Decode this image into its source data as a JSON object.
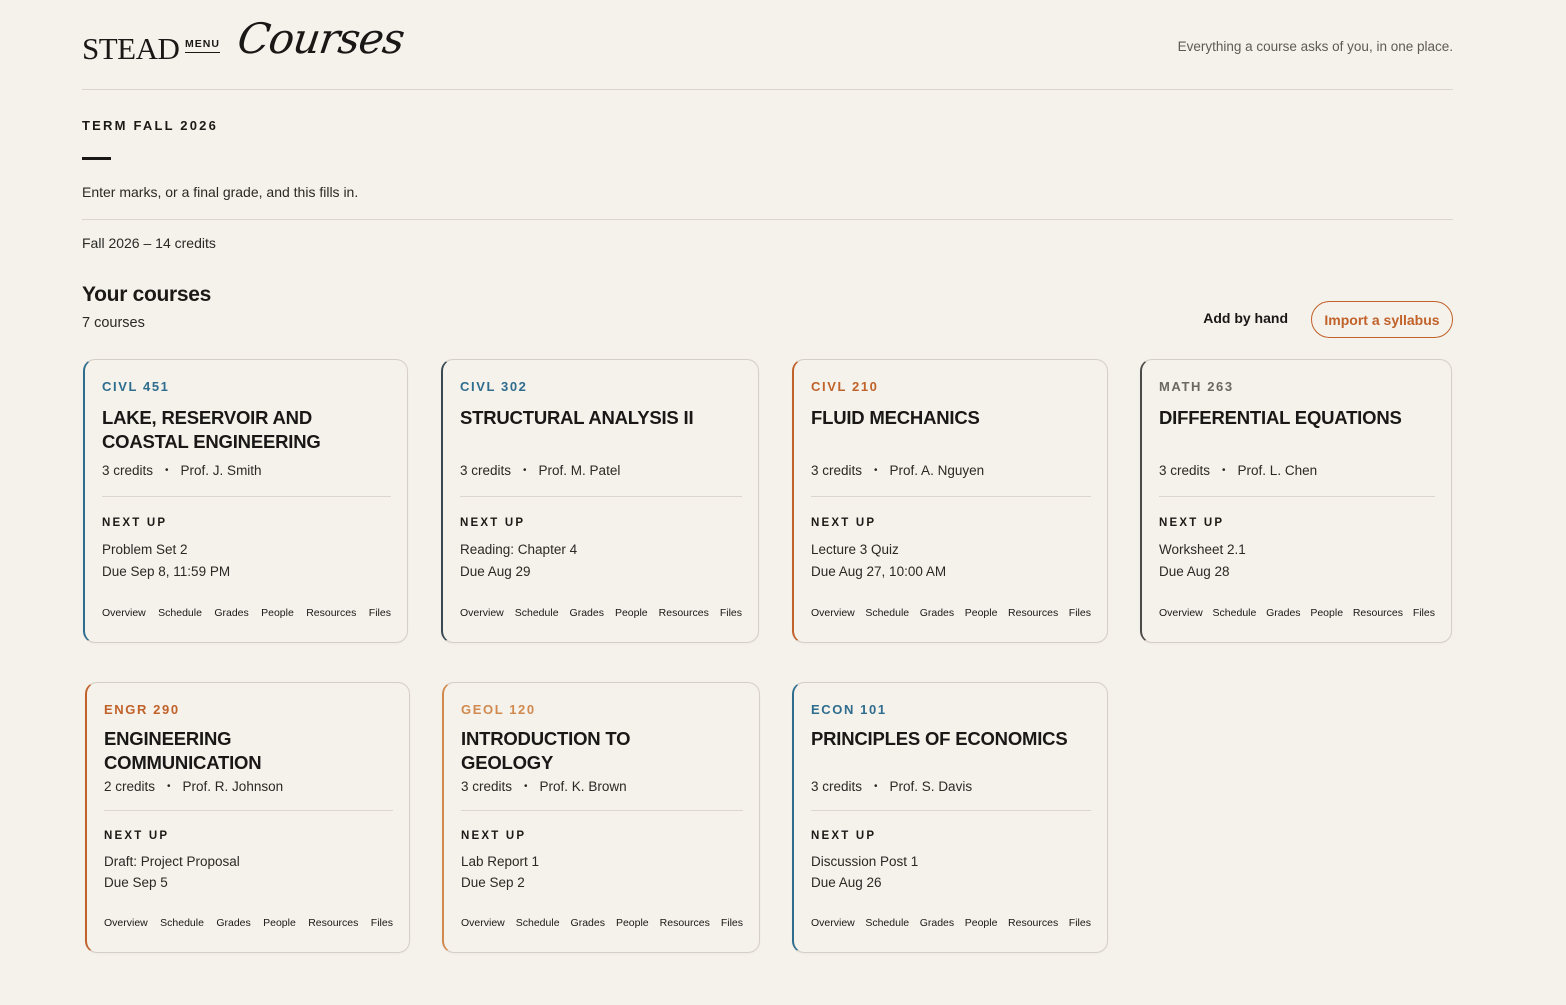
{
  "header": {
    "logo": "STEAD",
    "menu": "MENU",
    "section_title": "Courses",
    "tagline": "Everything a course asks of you, in one place."
  },
  "term": {
    "label": "TERM FALL 2026",
    "hint": "Enter marks, or a final grade, and this fills in.",
    "summary": "Fall 2026 – 14 credits"
  },
  "courses_section": {
    "title": "Your courses",
    "count": "7 courses",
    "add_by_hand": "Add by hand",
    "import_syllabus": "Import a syllabus"
  },
  "colors": {
    "blue": "#2e6d8e",
    "slate": "#3b4a52",
    "orange": "#c0622a",
    "amber": "#d08a4f",
    "gray": "#6b6863"
  },
  "card_links": [
    "Overview",
    "Schedule",
    "Grades",
    "People",
    "Resources",
    "Files"
  ],
  "next_up_label": "NEXT UP",
  "courses": [
    {
      "code": "CIVL 451",
      "title": "LAKE, RESERVOIR AND COASTAL ENGINEERING",
      "credits": "3 credits",
      "prof": "Prof. J. Smith",
      "next_item": "Problem Set 2",
      "next_due": "Due Sep 8, 11:59 PM",
      "accent": "#2e6d8e",
      "border": "#2e6d8e"
    },
    {
      "code": "CIVL 302",
      "title": "STRUCTURAL ANALYSIS II",
      "credits": "3 credits",
      "prof": "Prof. M. Patel",
      "next_item": "Reading: Chapter 4",
      "next_due": "Due Aug 29",
      "accent": "#2e6d8e",
      "border": "#3b4a52"
    },
    {
      "code": "CIVL 210",
      "title": "FLUID MECHANICS",
      "credits": "3 credits",
      "prof": "Prof. A. Nguyen",
      "next_item": "Lecture 3 Quiz",
      "next_due": "Due Aug 27, 10:00 AM",
      "accent": "#c0622a",
      "border": "#c0622a"
    },
    {
      "code": "MATH 263",
      "title": "DIFFERENTIAL EQUATIONS",
      "credits": "3 credits",
      "prof": "Prof. L. Chen",
      "next_item": "Worksheet 2.1",
      "next_due": "Due Aug 28",
      "accent": "#6b6863",
      "border": "#4a4a48"
    },
    {
      "code": "ENGR 290",
      "title": "ENGINEERING COMMUNICATION",
      "credits": "2 credits",
      "prof": "Prof. R. Johnson",
      "next_item": "Draft: Project Proposal",
      "next_due": "Due Sep 5",
      "accent": "#c0622a",
      "border": "#c0622a"
    },
    {
      "code": "GEOL 120",
      "title": "INTRODUCTION TO GEOLOGY",
      "credits": "3 credits",
      "prof": "Prof. K. Brown",
      "next_item": "Lab Report 1",
      "next_due": "Due Sep 2",
      "accent": "#d08a4f",
      "border": "#d08a4f"
    },
    {
      "code": "ECON 101",
      "title": "PRINCIPLES OF ECONOMICS",
      "credits": "3 credits",
      "prof": "Prof. S. Davis",
      "next_item": "Discussion Post 1",
      "next_due": "Due Aug 26",
      "accent": "#2e6d8e",
      "border": "#2e6d8e"
    }
  ]
}
